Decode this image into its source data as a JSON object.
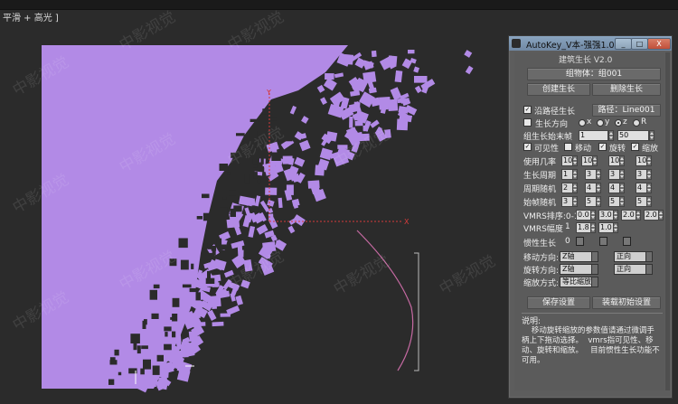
{
  "viewport": {
    "label": "平滑 + 高光 ]",
    "watermarks": [
      "中影视觉",
      "中影视觉",
      "中影视觉",
      "中影视觉",
      "中影视觉",
      "中影视觉",
      "中影视觉",
      "中影视觉",
      "中影视觉",
      "中影视觉",
      "中影视觉",
      "中影视觉"
    ],
    "gizmo_axes": {
      "y": "Y",
      "x": "X"
    },
    "object_color": "#b28ae6",
    "path_color": "#c76aa3"
  },
  "panel": {
    "title": "AutoKey_V本-强强1.0",
    "window_buttons": {
      "min": "_",
      "max": "□",
      "close": "X"
    },
    "section_title": "建筑生长 V2.0",
    "group_label": "组物体：组001",
    "create_btn": "创建生长",
    "delete_btn": "删除生长",
    "path_check_label": "沿路径生长",
    "path_btn": "路径：Line001",
    "grow_dir_label": "生长方向",
    "axes": [
      "x",
      "y",
      "z",
      "R"
    ],
    "group_start_label": "组生长始末帧",
    "start_frame": "1",
    "end_frame": "50",
    "visibility_label": "可见性",
    "move_label": "移动",
    "rotate_label": "旋转",
    "scale_label": "缩放",
    "prob_label": "使用几率",
    "prob_values": [
      "100",
      "100",
      "100",
      "100"
    ],
    "period_label": "生长周期",
    "period_values": [
      "1",
      "3",
      "3",
      "3"
    ],
    "rand_label": "周期随机",
    "rand_values": [
      "2",
      "4",
      "4",
      "4"
    ],
    "start_rand_label": "始帧随机",
    "start_rand_values": [
      "3",
      "5",
      "5",
      "5"
    ],
    "vmrs_label": "VMRS排序:0-1",
    "vmrs_values": [
      "0.0",
      "3.0",
      "2.0",
      "2.0"
    ],
    "vmrs_amp_label": "VMRS幅度",
    "vmrs_amp_value": "1",
    "vmrs_amp_values": [
      "1.8",
      "1.0"
    ],
    "inertia_label": "惯性生长",
    "inertia_value": "0",
    "move_dir_label": "移动方向:",
    "move_dir_value": "Z轴",
    "move_dir_value2": "正向",
    "rot_dir_label": "旋转方向:",
    "rot_dir_value": "Z轴",
    "rot_dir_value2": "正向",
    "scale_mode_label": "缩放方式:",
    "scale_mode_value": "等比缩放",
    "save_btn": "保存设置",
    "load_btn": "装载初始设置",
    "desc_title": "说明:",
    "desc_body": "    移动旋转缩放的参数值请通过微调手柄上下拖动选择。  vmrs指可见性、移动、旋转和缩放。   目前惯性生长功能不可用。"
  }
}
